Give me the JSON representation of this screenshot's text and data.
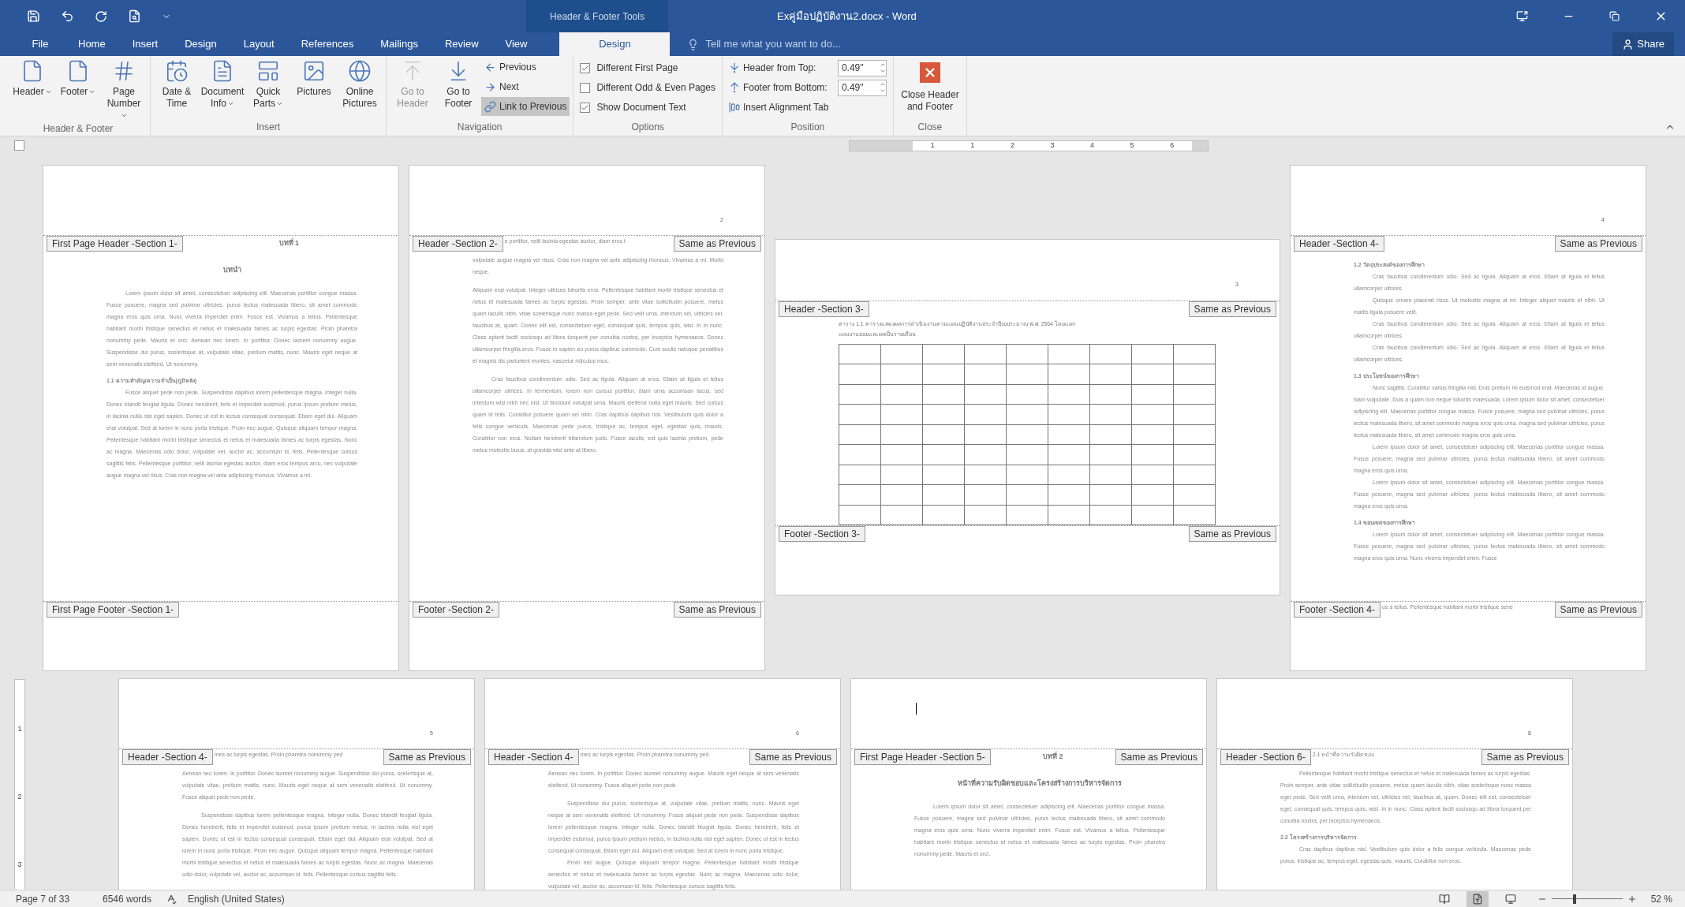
{
  "window": {
    "contextual_label": "Header & Footer Tools",
    "title": "Exคู่มือปฏิบัติงาน2.docx - Word",
    "share": "Share"
  },
  "tabs": [
    {
      "label": "File",
      "selected": false,
      "kind": "file"
    },
    {
      "label": "Home",
      "selected": false,
      "kind": "normal"
    },
    {
      "label": "Insert",
      "selected": false,
      "kind": "normal"
    },
    {
      "label": "Design",
      "selected": false,
      "kind": "normal"
    },
    {
      "label": "Layout",
      "selected": false,
      "kind": "normal"
    },
    {
      "label": "References",
      "selected": false,
      "kind": "normal"
    },
    {
      "label": "Mailings",
      "selected": false,
      "kind": "normal"
    },
    {
      "label": "Review",
      "selected": false,
      "kind": "normal"
    },
    {
      "label": "View",
      "selected": false,
      "kind": "normal"
    },
    {
      "label": "Design",
      "selected": true,
      "kind": "contextual"
    }
  ],
  "tell_me": {
    "placeholder": "Tell me what you want to do..."
  },
  "ribbon": [
    {
      "label": "Header & Footer",
      "items": [
        {
          "kind": "large",
          "label": "Header",
          "menu": true,
          "disabled": false
        },
        {
          "kind": "large",
          "label": "Footer",
          "menu": true,
          "disabled": false
        },
        {
          "kind": "large",
          "label": "Page Number",
          "menu": true,
          "disabled": false
        }
      ]
    },
    {
      "label": "Insert",
      "items": [
        {
          "kind": "large",
          "label": "Date & Time",
          "menu": false,
          "disabled": false
        },
        {
          "kind": "large",
          "label": "Document Info",
          "menu": true,
          "disabled": false
        },
        {
          "kind": "large",
          "label": "Quick Parts",
          "menu": true,
          "disabled": false
        },
        {
          "kind": "large",
          "label": "Pictures",
          "menu": false,
          "disabled": false
        },
        {
          "kind": "large",
          "label": "Online Pictures",
          "menu": false,
          "disabled": false
        }
      ]
    },
    {
      "label": "Navigation",
      "items": [
        {
          "kind": "large",
          "label": "Go to Header",
          "menu": false,
          "disabled": true
        },
        {
          "kind": "large",
          "label": "Go to Footer",
          "menu": false,
          "disabled": false
        },
        {
          "kind": "stack",
          "items": [
            {
              "label": "Previous",
              "selected": false
            },
            {
              "label": "Next",
              "selected": false
            },
            {
              "label": "Link to Previous",
              "selected": true
            }
          ]
        }
      ]
    },
    {
      "label": "Options",
      "items": [
        {
          "kind": "checks",
          "items": [
            {
              "label": "Different First Page",
              "checked": true
            },
            {
              "label": "Different Odd & Even Pages",
              "checked": false
            },
            {
              "label": "Show Document Text",
              "checked": true
            }
          ]
        }
      ]
    },
    {
      "label": "Position",
      "items": [
        {
          "kind": "position",
          "items": [
            {
              "kind": "spinner",
              "label": "Header from Top:",
              "value": "0.49\""
            },
            {
              "kind": "spinner",
              "label": "Footer from Bottom:",
              "value": "0.49\""
            },
            {
              "kind": "command",
              "label": "Insert Alignment Tab"
            }
          ]
        }
      ]
    },
    {
      "label": "Close",
      "items": [
        {
          "kind": "close",
          "label": "Close Header and Footer"
        }
      ]
    }
  ],
  "ruler": {
    "numbers": [
      "1",
      "1",
      "2",
      "3",
      "4",
      "5",
      "6"
    ]
  },
  "vertical_ruler": {
    "numbers": [
      "1",
      "2",
      "3"
    ]
  },
  "page_rows": [
    [
      {
        "kind": "portrait",
        "header": {
          "label": "First Page Header -Section 1-",
          "title": "บทที่ 1"
        },
        "blocks": [
          {
            "kind": "title",
            "text": "บทนำ"
          },
          {
            "kind": "paragraph",
            "text": "Lorem ipsum dolor sit amet, consectetuer adipiscing elit. Maecenas porttitor congue massa. Fusce posuere, magna sed pulvinar ultricies, purus lectus malesuada libero, sit amet commodo magna eros quis urna. Nunc viverra imperdiet enim. Fusce est. Vivamus a tellus. Pellentesque habitant morbi tristique senectus et netus et malesuada fames ac turpis egestas. Proin pharetra nonummy pede. Mauris et orci. Aenean nec lorem. In porttitor. Donec laoreet nonummy augue. Suspendisse dui purus, scelerisque at, vulputate vitae, pretium mattis, nunc. Mauris eget neque at sem venenatis eleifend. Ut nonummy."
          },
          {
            "kind": "heading",
            "text": "1.1 ความสำคัญ/ความจำเป็น(ภูมิหลัง)"
          },
          {
            "kind": "paragraph",
            "text": "Fusce aliquet pede non pede. Suspendisse dapibus lorem pellentesque magna. Integer nulla. Donec blandit feugiat ligula. Donec hendrerit, felis et imperdiet euismod, purus ipsum pretium metus, in lacinia nulla nisl eget sapien. Donec ut est in lectus consequat consequat. Etiam eget dui. Aliquam erat volutpat. Sed at lorem in nunc porta tristique. Proin nec augue. Quisque aliquam tempor magna. Pellentesque habitant morbi tristique senectus et netus et malesuada fames ac turpis egestas. Nunc ac magna. Maecenas odio dolor, vulputate vel, auctor ac, accumsan id, felis. Pellentesque cursus sagittis felis. Pellentesque porttitor, velit lacinia egestas auctor, diam eros tempus arcu, nec vulputate augue magna vel risus. Cras non magna vel ante adipiscing rhoncus. Vivamus a mi."
          }
        ],
        "footer": {
          "label": "First Page Footer -Section 1-"
        }
      },
      {
        "kind": "portrait",
        "page_number": "2",
        "header": {
          "label": "Header -Section 2-",
          "text": "e porttitor, velit lacinia egestas auctor, diam eros t",
          "link": "Same as Previous"
        },
        "blocks": [
          {
            "kind": "text",
            "text": "vulputate augue magna vel risus. Cras non magna vel ante adipiscing rhoncus. Vivamus a mi. Morbi neque."
          },
          {
            "kind": "text",
            "text": "Aliquam erat volutpat. Integer ultrices lobortis eros. Pellentesque habitant morbi tristique senectus et netus et malesuada fames ac turpis egestas. Proin semper, ante vitae sollicitudin posuere, metus quam iaculis nibh, vitae scelerisque nunc massa eget pede. Sed velit urna, interdum vel, ultricies vel, faucibus at, quam. Donec elit est, consectetuer eget, consequat quis, tempus quis, wisi. In in nunc. Class aptent taciti sociosqu ad litora torquent per conubia nostra, per inceptos hymenaeos. Donec ullamcorper fringilla eros. Fusce in sapien eu purus dapibus commodo. Cum sociis natoque penatibus et magnis dis parturient montes, nascetur ridiculus mus."
          },
          {
            "kind": "paragraph",
            "text": "Cras faucibus condimentum odio. Sed ac ligula. Aliquam at eros. Etiam at ligula et tellus ullamcorper ultrices. In fermentum, lorem non cursus porttitor, diam urna accumsan lacus, sed interdum wisi nibh nec nisl. Ut tincidunt volutpat urna. Mauris eleifend nulla eget mauris. Sed cursus quam id felis. Curabitur posuere quam vel nibh. Cras dapibus dapibus nisl. Vestibulum quis dolor a felis congue vehicula. Maecenas pede purus, tristique ac, tempus eget, egestas quis, mauris. Curabitur non eros. Nullam hendrerit bibendum justo. Fusce iaculis, est quis lacinia pretium, pede metus molestie lacus, at gravida wisi ante at libero."
          }
        ],
        "footer": {
          "label": "Footer -Section 2-",
          "link": "Same as Previous"
        }
      },
      {
        "kind": "landscape",
        "page_number": "3",
        "header": {
          "label": "Header -Section 3-",
          "link": "Same as Previous"
        },
        "blocks": [
          {
            "kind": "caption",
            "text": "ตาราง 1.1 ตารางแสดงผลการดำเนินงานตามแผนปฏิบัติงานประจำปีงบประมาณ พ.ศ. 2564 โดยแยก"
          },
          {
            "kind": "caption",
            "text": "แผนงานย่อยและผลเป็นรายเดือน"
          },
          {
            "kind": "table"
          }
        ],
        "footer": {
          "label": "Footer -Section 3-",
          "link": "Same as Previous"
        }
      },
      {
        "kind": "portrait",
        "page_number": "4",
        "header": {
          "label": "Header -Section 4-",
          "link": "Same as Previous"
        },
        "blocks": [
          {
            "kind": "heading",
            "text": "1.2 วัตถุประสงค์ของการศึกษา"
          },
          {
            "kind": "paragraph",
            "text": "Cras faucibus condimentum odio. Sed ac ligula. Aliquam at eros. Etiam at ligula et tellus ullamcorper ultrices."
          },
          {
            "kind": "paragraph",
            "text": "Quisque ornare placerat risus. Ut molestie magna at mi. Integer aliquet mauris et nibh. Ut mattis ligula posuere velit."
          },
          {
            "kind": "paragraph",
            "text": "Cras faucibus condimentum odio. Sed ac ligula. Aliquam at eros. Etiam at ligula et tellus ullamcorper ultrices."
          },
          {
            "kind": "paragraph",
            "text": "Cras faucibus condimentum odio. Sed ac ligula. Aliquam at eros. Etiam at ligula et tellus ullamcorper ultrices."
          },
          {
            "kind": "heading",
            "text": "1.3 ประโยชน์ของการศึกษา"
          },
          {
            "kind": "paragraph",
            "text": "Nunc sagittis. Curabitur varius fringilla nisl. Duis pretium mi euismod erat. Maecenas id augue. Nam vulputate. Duis a quam non neque lobortis malesuada. Lorem ipsum dolor sit amet, consectetuer adipiscing elit. Maecenas porttitor congue massa. Fusce posuere, magna sed pulvinar ultricies, purus lectus malesuada libero, sit amet commodo magna eros quis urna. magna sed pulvinar ultricies, purus lectus malesuada libero, sit amet commodo magna eros quis urna."
          },
          {
            "kind": "paragraph",
            "text": "Lorem ipsum dolor sit amet, consectetuer adipiscing elit. Maecenas porttitor congue massa. Fusce posuere, magna sed pulvinar ultricies, purus lectus malesuada libero, sit amet commodo magna eros quis urna."
          },
          {
            "kind": "paragraph",
            "text": "Lorem ipsum dolor sit amet, consectetuer adipiscing elit. Maecenas porttitor congue massa. Fusce posuere, magna sed pulvinar ultricies, purus lectus malesuada libero, sit amet commodo magna eros quis urna."
          },
          {
            "kind": "heading",
            "text": "1.4 ขอบเขตของการศึกษา"
          },
          {
            "kind": "paragraph",
            "text": "Lorem ipsum dolor sit amet, consectetuer adipiscing elit. Maecenas porttitor congue massa. Fusce posuere, magna sed pulvinar ultricies, purus lectus malesuada libero, sit amet commodo magna eros quis urna. Nunc viverra imperdiet enim. Fusce"
          }
        ],
        "footer": {
          "label": "Footer -Section 4-",
          "text": "us a tellus. Pellentesque habitant morbi tristique sene",
          "link": "Same as Previous"
        }
      }
    ],
    [
      {
        "kind": "portrait",
        "page_number": "5",
        "header": {
          "label": "Header -Section 4-",
          "text": "mes ac turpis egestas. Proin pharetra nonummy ped",
          "link": "Same as Previous"
        },
        "blocks": [
          {
            "kind": "text",
            "text": "Aenean nec lorem. In porttitor. Donec laoreet nonummy augue. Suspendisse dui purus, scelerisque at, vulputate vitae, pretium mattis, nunc. Mauris eget neque at sem venenatis eleifend. Ut nonummy. Fusce aliquet pede non pede."
          },
          {
            "kind": "paragraph",
            "text": "Suspendisse dapibus lorem pellentesque magna. Integer nulla. Donec blandit feugiat ligula. Donec hendrerit, felis et imperdiet euismod, purus ipsum pretium metus, in lacinia nulla nisl eget sapien. Donec ut est in lectus consequat consequat. Etiam eget dui. Aliquam erat volutpat. Sed at lorem in nunc porta tristique. Proin nec augue. Quisque aliquam tempor magna. Pellentesque habitant morbi tristique senectus et netus et malesuada fames ac turpis egestas. Nunc ac magna. Maecenas odio dolor, vulputate vel, auctor ac, accumsan id, felis. Pellentesque cursus sagittis felis."
          }
        ]
      },
      {
        "kind": "portrait",
        "page_number": "6",
        "header": {
          "label": "Header -Section 4-",
          "text": "mes ac turpis egestas. Proin pharetra nonummy ped",
          "link": "Same as Previous"
        },
        "blocks": [
          {
            "kind": "text",
            "text": "Aenean nec lorem. In porttitor. Donec laoreet nonummy augue. Mauris eget neque at sem venenatis eleifend. Ut nonummy. Fusce aliquet pede non pede."
          },
          {
            "kind": "paragraph",
            "text": "Suspendisse dui purus, scelerisque at, vulputate vitae, pretium mattis, nunc. Mauris eget neque at sem venenatis eleifend. Ut nonummy. Fusce aliquet pede non pede. Suspendisse dapibus lorem pellentesque magna. Integer nulla. Donec blandit feugiat ligula. Donec hendrerit, felis et imperdiet euismod, purus ipsum pretium metus, in lacinia nulla nisl eget sapien. Donec ut est in lectus consequat consequat. Etiam eget dui. Aliquam erat volutpat. Sed at lorem in nunc porta tristique."
          },
          {
            "kind": "paragraph",
            "text": "Proin nec augue. Quisque aliquam tempor magna. Pellentesque habitant morbi tristique senectus et netus et malesuada fames ac turpis egestas. Nunc ac magna. Maecenas odio dolor, vulputate vel, auctor ac, accumsan id, felis. Pellentesque cursus sagittis felis."
          }
        ]
      },
      {
        "kind": "portrait",
        "text_cursor": true,
        "header": {
          "label": "First Page Header -Section 5-",
          "title": "บทที่ 2",
          "link": "Same as Previous"
        },
        "blocks": [
          {
            "kind": "title",
            "text": "หน้าที่ความรับผิดชอบและโครงสร้างการบริหารจัดการ"
          },
          {
            "kind": "paragraph",
            "text": "Lorem ipsum dolor sit amet, consectetuer adipiscing elit. Maecenas porttitor congue massa. Fusce posuere, magna sed pulvinar ultricies, purus lectus malesuada libero, sit amet commodo magna eros quis urna. Nunc viverra imperdiet enim. Fusce est. Vivamus a tellus. Pellentesque habitant morbi tristique senectus et netus et malesuada fames ac turpis egestas. Proin pharetra nonummy pede. Mauris et orci."
          }
        ]
      },
      {
        "kind": "portrait",
        "page_number": "8",
        "header": {
          "label": "Header -Section 6-",
          "text": "2.1 หน้าที่ความรับผิดชอบ",
          "link": "Same as Previous"
        },
        "blocks": [
          {
            "kind": "paragraph",
            "text": "Pellentesque habitant morbi tristique senectus et netus et malesuada fames ac turpis egestas. Proin semper, ante vitae sollicitudin posuere, metus quam iaculis nibh, vitae scelerisque nunc massa eget pede. Sed velit urna, interdum vel, ultricies vel, faucibus at, quam. Donec elit est, consectetuer eget, consequat quis, tempus quis, wisi. In in nunc. Class aptent taciti sociosqu ad litora torquent per conubia nostra, per inceptos hymenaeos."
          },
          {
            "kind": "heading",
            "text": "2.2 โครงสร้างการบริหารจัดการ"
          },
          {
            "kind": "paragraph",
            "text": "Cras dapibus dapibus nisl. Vestibulum quis dolor a felis congue vehicula. Maecenas pede purus, tristique ac, tempus eget, egestas quis, mauris. Curabitur non eros."
          }
        ]
      }
    ]
  ],
  "status_bar": {
    "page": "Page 7 of 33",
    "words": "6546 words",
    "language": "English (United States)",
    "views": [
      {
        "kind": "read",
        "selected": false
      },
      {
        "kind": "print",
        "selected": true
      },
      {
        "kind": "web",
        "selected": false
      }
    ],
    "zoom": {
      "level": 0.3,
      "reading": "52 %"
    }
  }
}
